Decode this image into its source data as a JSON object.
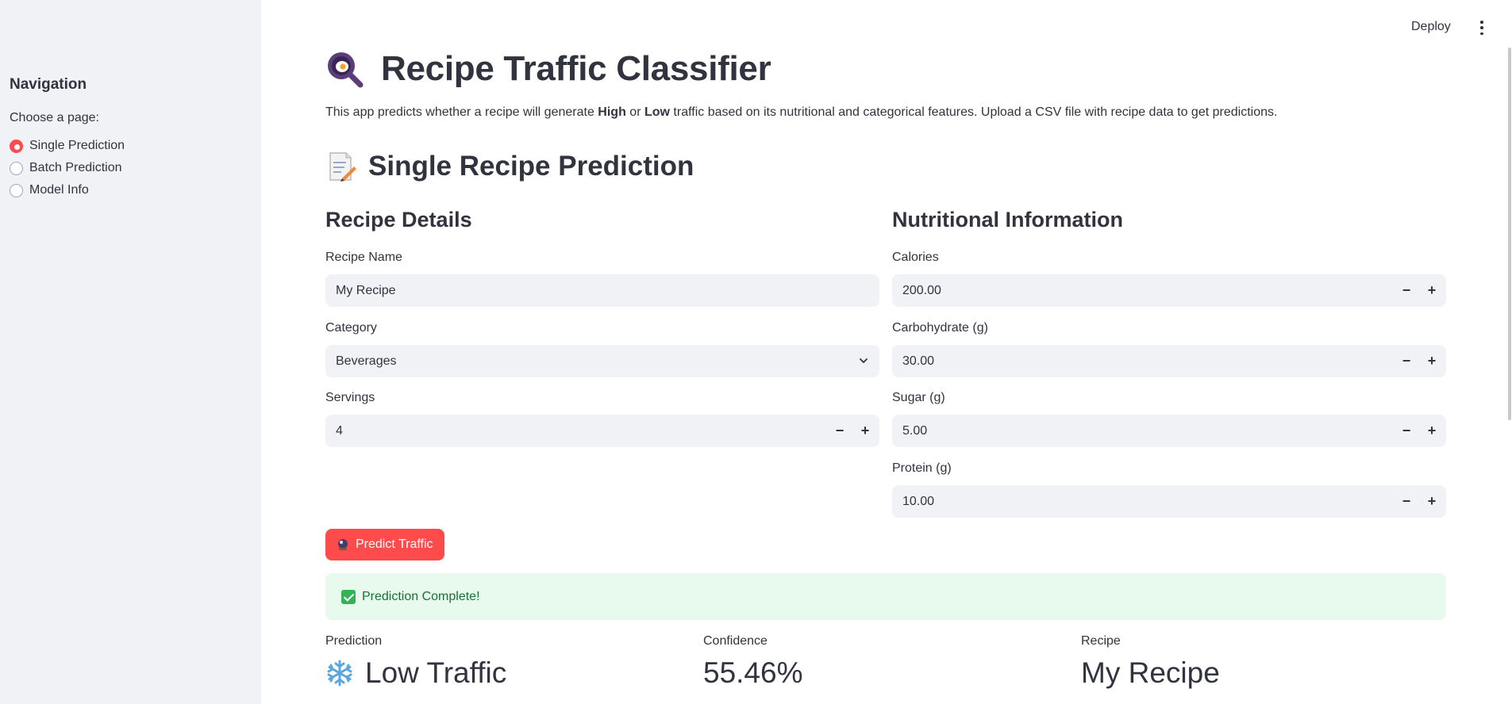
{
  "header": {
    "deploy_label": "Deploy"
  },
  "sidebar": {
    "title": "Navigation",
    "prompt": "Choose a page:",
    "items": [
      {
        "label": "Single Prediction",
        "selected": true
      },
      {
        "label": "Batch Prediction",
        "selected": false
      },
      {
        "label": "Model Info",
        "selected": false
      }
    ]
  },
  "main": {
    "title": "Recipe Traffic Classifier",
    "desc_1": "This app predicts whether a recipe will generate ",
    "desc_high": "High",
    "desc_2": " or ",
    "desc_low": "Low",
    "desc_3": " traffic based on its nutritional and categorical features. Upload a CSV file with recipe data to get predictions.",
    "section_title": "Single Recipe Prediction",
    "left_heading": "Recipe Details",
    "right_heading": "Nutritional Information",
    "recipe_name_label": "Recipe Name",
    "recipe_name_value": "My Recipe",
    "category_label": "Category",
    "category_value": "Beverages",
    "servings_label": "Servings",
    "servings_value": "4",
    "calories_label": "Calories",
    "calories_value": "200.00",
    "carbs_label": "Carbohydrate (g)",
    "carbs_value": "30.00",
    "sugar_label": "Sugar (g)",
    "sugar_value": "5.00",
    "protein_label": "Protein (g)",
    "protein_value": "10.00",
    "stepper_minus": "−",
    "stepper_plus": "+",
    "predict_button": "Predict Traffic",
    "alert_text": "Prediction Complete!",
    "metrics": {
      "prediction_label": "Prediction",
      "prediction_value": "Low Traffic",
      "confidence_label": "Confidence",
      "confidence_value": "55.46%",
      "recipe_label": "Recipe",
      "recipe_value": "My Recipe"
    }
  },
  "colors": {
    "accent": "#ff4b4b",
    "sidebar_bg": "#f0f2f6",
    "success_bg": "#e8f9ee",
    "success_text": "#177233"
  },
  "icons": [
    "frying-pan-icon",
    "memo-icon",
    "crystal-ball-icon",
    "check-icon",
    "snowflake-icon",
    "chevron-down-icon",
    "kebab-menu-icon"
  ]
}
